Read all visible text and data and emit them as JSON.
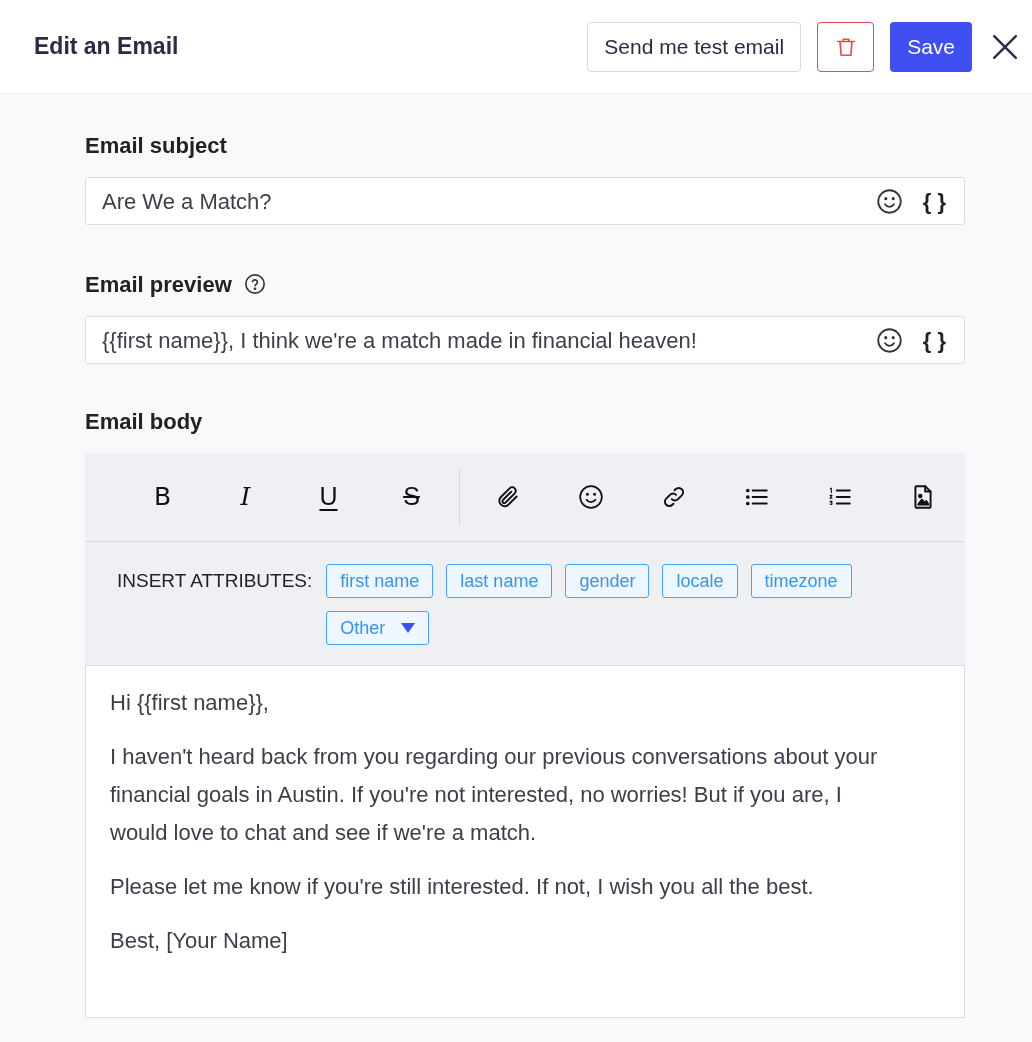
{
  "header": {
    "title": "Edit an Email",
    "buttons": [
      {
        "kind": "outline",
        "label": "Send me test email"
      },
      {
        "kind": "delete"
      },
      {
        "kind": "primary",
        "label": "Save"
      },
      {
        "kind": "close"
      }
    ]
  },
  "fields": [
    {
      "label": "Email subject",
      "help": false,
      "value": "Are We a Match?",
      "variable_label": "{ }"
    },
    {
      "label": "Email preview",
      "help": true,
      "value": "{{first name}}, I think we're a match made in financial heaven!",
      "variable_label": "{ }"
    }
  ],
  "body": {
    "label": "Email body",
    "toolbar": [
      {
        "kind": "bold",
        "label": "B"
      },
      {
        "kind": "italic",
        "label": "I"
      },
      {
        "kind": "underline",
        "label": "U"
      },
      {
        "kind": "strike",
        "label": "S"
      },
      {
        "kind": "divider"
      },
      {
        "kind": "attach"
      },
      {
        "kind": "emoji"
      },
      {
        "kind": "link"
      },
      {
        "kind": "bullets"
      },
      {
        "kind": "numbered"
      },
      {
        "kind": "image"
      }
    ],
    "attributes_label": "INSERT ATTRIBUTES:",
    "attributes": [
      {
        "label": "first name",
        "dropdown": false
      },
      {
        "label": "last name",
        "dropdown": false
      },
      {
        "label": "gender",
        "dropdown": false
      },
      {
        "label": "locale",
        "dropdown": false
      },
      {
        "label": "timezone",
        "dropdown": false
      },
      {
        "label": "Other",
        "dropdown": true
      }
    ],
    "paragraphs": [
      "Hi {{first name}},",
      "I haven't heard back from you regarding our previous conversations about your financial goals in Austin. If you're not interested, no worries! But if you are, I would love to chat and see if we're a match.",
      "Please let me know if you're still interested. If not, I wish you all the best.",
      "Best, [Your Name]"
    ]
  }
}
